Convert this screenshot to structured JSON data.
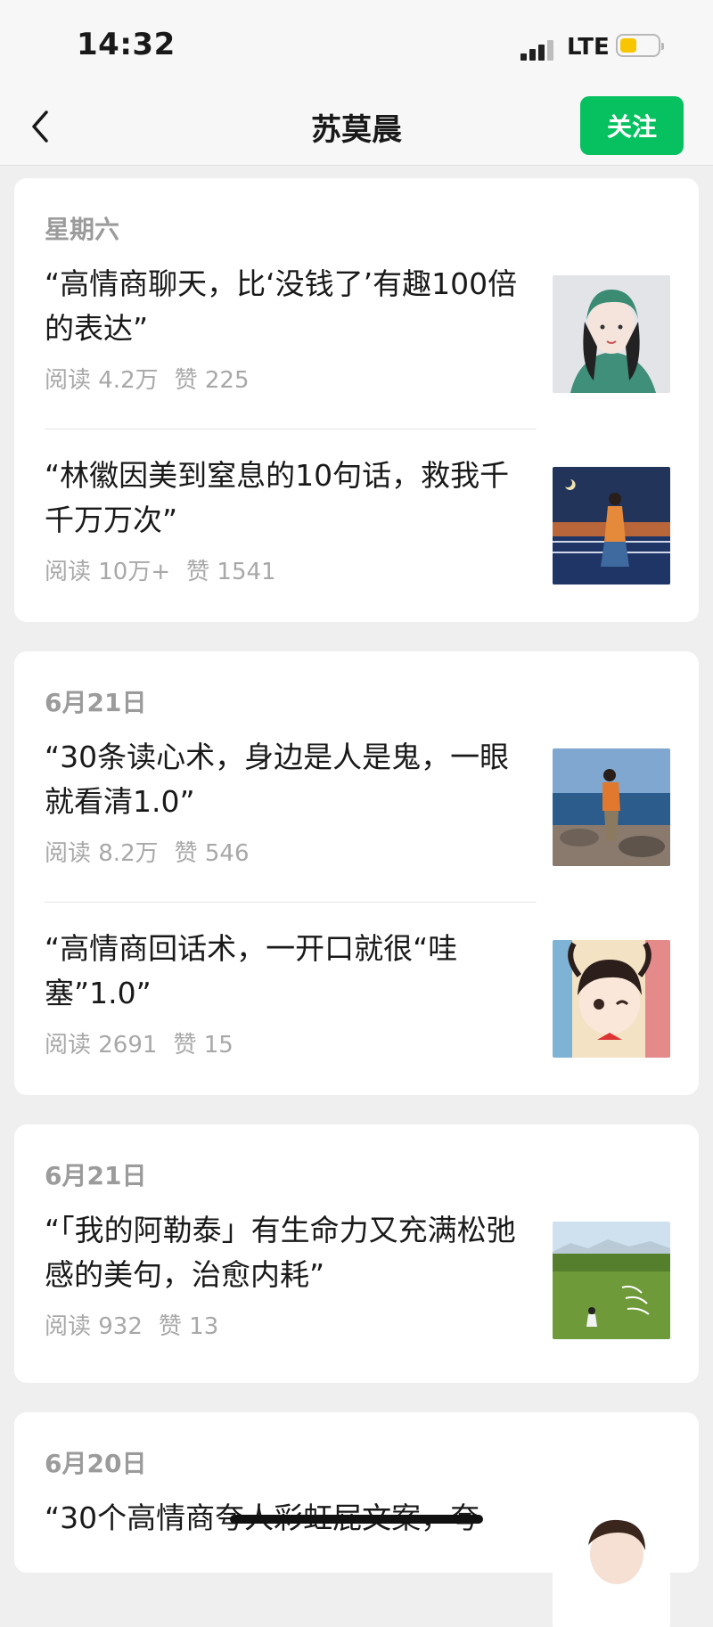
{
  "status": {
    "time": "14:32",
    "network": "LTE"
  },
  "nav": {
    "title": "苏莫晨",
    "follow_label": "关注"
  },
  "groups": [
    {
      "date": "星期六",
      "articles": [
        {
          "title": "“高情商聊天，比‘没钱了’有趣100倍的表达”",
          "reads": "阅读 4.2万",
          "likes": "赞 225"
        },
        {
          "title": "“林徽因美到窒息的10句话，救我千千万万次”",
          "reads": "阅读 10万+",
          "likes": "赞 1541"
        }
      ]
    },
    {
      "date": "6月21日",
      "articles": [
        {
          "title": "“30条读心术，身边是人是鬼，一眼就看清1.0”",
          "reads": "阅读 8.2万",
          "likes": "赞 546"
        },
        {
          "title": "“高情商回话术，一开口就很“哇塞”1.0”",
          "reads": "阅读 2691",
          "likes": "赞 15"
        }
      ]
    },
    {
      "date": "6月21日",
      "articles": [
        {
          "title": "“「我的阿勒泰」有生命力又充满松弛感的美句，治愈内耗”",
          "reads": "阅读 932",
          "likes": "赞 13"
        }
      ]
    },
    {
      "date": "6月20日",
      "articles": [
        {
          "title": "“30个高情商夸人彩虹屁文案，夸",
          "reads": "",
          "likes": ""
        }
      ]
    }
  ]
}
